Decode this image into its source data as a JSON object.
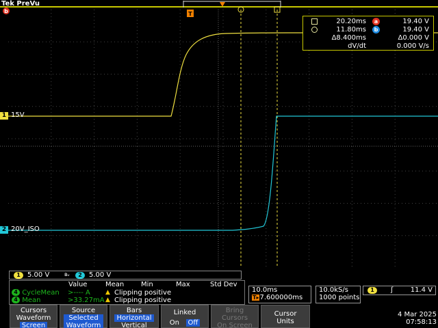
{
  "header": {
    "title": "Tek PreVu"
  },
  "cursor_readout": {
    "a_time": "20.20ms",
    "a_value": "19.40 V",
    "a_badge": "a",
    "b_time": "11.80ms",
    "b_value": "19.40 V",
    "b_badge": "b",
    "delta_time": "Δ8.400ms",
    "delta_value": "Δ0.000 V",
    "dvdt_label": "dV/dt",
    "dvdt_value": "0.000 V/s"
  },
  "channels": [
    {
      "num": "1",
      "label": "15V",
      "color": "#f0e040"
    },
    {
      "num": "2",
      "label": "20V_ISO",
      "color": "#22c8d8"
    }
  ],
  "markers": {
    "trigger": "T",
    "b_marker": "b"
  },
  "scale": {
    "ch1": "5.00 V",
    "ch2": "5.00 V",
    "bw": "ʙᵥ"
  },
  "measurements": {
    "headers": [
      "Value",
      "Mean",
      "Min",
      "Max",
      "Std Dev"
    ],
    "rows": [
      {
        "num": "4",
        "name": "CycleMean",
        "value": ">---- A",
        "status": "Clipping positive"
      },
      {
        "num": "4",
        "name": "Mean",
        "value": ">33.27mA",
        "status": "Clipping positive"
      }
    ]
  },
  "timebase": {
    "scale": "10.0ms",
    "position": "7.600000ms",
    "rate": "10.0kS/s",
    "points": "1000 points"
  },
  "trigger": {
    "num": "1",
    "level": "11.4 V"
  },
  "menu": [
    {
      "line1": "Cursors",
      "line2": "Waveform",
      "line3": "Screen"
    },
    {
      "line1": "Source",
      "line2": "Selected",
      "line3": "Waveform"
    },
    {
      "line1": "Bars",
      "line2": "Horizontal",
      "line3": "Vertical"
    },
    {
      "line1": "Linked",
      "on": "On",
      "off": "Off"
    },
    {
      "line1": "Bring",
      "line2": "Cursors",
      "line3": "On Screen"
    },
    {
      "line1": "Cursor",
      "line2": "Units"
    }
  ],
  "date": {
    "day": "4 Mar 2025",
    "time": "07:58:13"
  }
}
